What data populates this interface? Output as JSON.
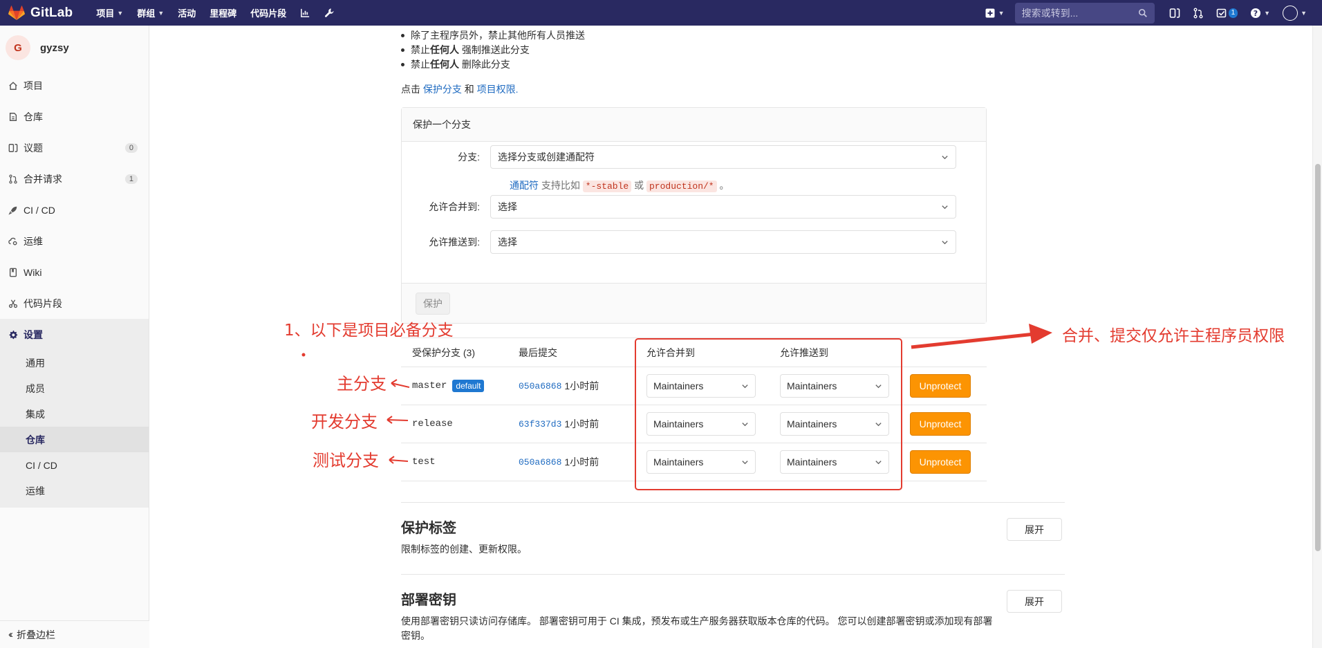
{
  "nav": {
    "brand": "GitLab",
    "items": [
      "项目",
      "群组",
      "活动",
      "里程碑",
      "代码片段"
    ],
    "search_placeholder": "搜索或转到...",
    "todo_count": "1"
  },
  "sidebar": {
    "project_initial": "G",
    "project_name": "gyzsy",
    "items": [
      {
        "label": "项目",
        "icon": "home-icon"
      },
      {
        "label": "仓库",
        "icon": "repository-icon"
      },
      {
        "label": "议题",
        "icon": "issues-icon",
        "count": "0"
      },
      {
        "label": "合并请求",
        "icon": "merge-request-icon",
        "count": "1"
      },
      {
        "label": "CI / CD",
        "icon": "rocket-icon"
      },
      {
        "label": "运维",
        "icon": "cloud-gear-icon"
      },
      {
        "label": "Wiki",
        "icon": "book-icon"
      },
      {
        "label": "代码片段",
        "icon": "scissors-icon"
      },
      {
        "label": "设置",
        "icon": "gear-icon"
      }
    ],
    "settings_sub": [
      "通用",
      "成员",
      "集成",
      "仓库",
      "CI / CD",
      "运维"
    ],
    "collapse": "折叠边栏"
  },
  "rules": {
    "bullet1": "除了主程序员外，禁止其他所有人员推送",
    "bullet2_pre": "禁止",
    "bullet2_bold": "任何人",
    "bullet2_post": " 强制推送此分支",
    "bullet3_pre": "禁止",
    "bullet3_bold": "任何人",
    "bullet3_post": " 删除此分支",
    "read_pre": "点击 ",
    "read_link1": "保护分支",
    "read_mid": " 和 ",
    "read_link2": "项目权限.",
    "read_post": ""
  },
  "protect_form": {
    "title": "保护一个分支",
    "branch_label": "分支:",
    "branch_placeholder": "选择分支或创建通配符",
    "hint_link": "通配符",
    "hint_text": " 支持比如 ",
    "hint_code1": "*-stable",
    "hint_or": " 或 ",
    "hint_code2": "production/*",
    "hint_end": " 。",
    "merge_label": "允许合并到:",
    "merge_value": "选择",
    "push_label": "允许推送到:",
    "push_value": "选择",
    "submit": "保护"
  },
  "protected_table": {
    "headers": [
      "受保护分支 (3)",
      "最后提交",
      "允许合并到",
      "允许推送到"
    ],
    "rows": [
      {
        "branch": "master",
        "badge": "default",
        "sha": "050a6868",
        "time": "1小时前",
        "merge": "Maintainers",
        "push": "Maintainers",
        "action": "Unprotect"
      },
      {
        "branch": "release",
        "badge": "",
        "sha": "63f337d3",
        "time": "1小时前",
        "merge": "Maintainers",
        "push": "Maintainers",
        "action": "Unprotect"
      },
      {
        "branch": "test",
        "badge": "",
        "sha": "050a6868",
        "time": "1小时前",
        "merge": "Maintainers",
        "push": "Maintainers",
        "action": "Unprotect"
      }
    ]
  },
  "sections": [
    {
      "title": "保护标签",
      "desc": "限制标签的创建、更新权限。",
      "button": "展开"
    },
    {
      "title": "部署密钥",
      "desc": "使用部署密钥只读访问存储库。 部署密钥可用于 CI 集成，预发布或生产服务器获取版本仓库的代码。 您可以创建部署密钥或添加现有部署密钥。",
      "button": "展开"
    }
  ],
  "annotations": {
    "required": "1、以下是项目必备分支",
    "main": "主分支",
    "dev": "开发分支",
    "test": "测试分支",
    "permission": "合并、提交仅允许主程序员权限",
    "color": "#e33b2f"
  }
}
